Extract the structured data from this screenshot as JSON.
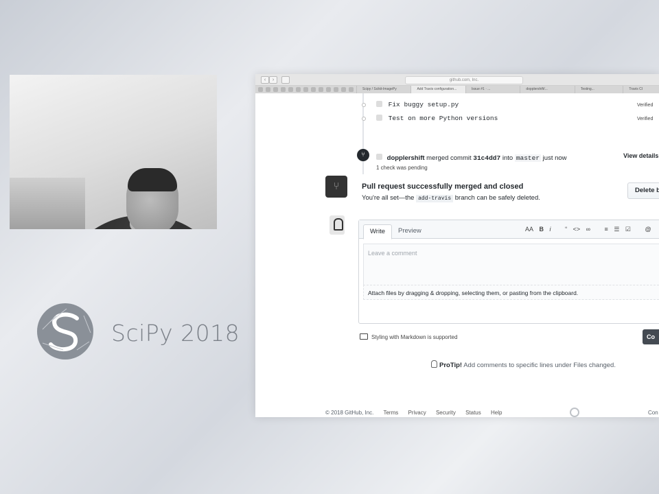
{
  "scipy": {
    "title": "SciPy 2018"
  },
  "browser": {
    "url": "github.com, Inc.",
    "tabs": [
      "Scipy / Scikit-ImagePy",
      "Add Travis configuration...",
      "Issue #1 · ...",
      "dopplershift/...",
      "Testing...",
      "Travis CI"
    ]
  },
  "commits": [
    {
      "message": "Fix buggy setup.py",
      "status": "Verified"
    },
    {
      "message": "Test on more Python versions",
      "status": "Verified"
    }
  ],
  "merge_event": {
    "user": "dopplershift",
    "text_merged": "merged commit",
    "sha": "31c4dd7",
    "text_into": "into",
    "branch": "master",
    "time": "just now",
    "view_details": "View details",
    "check_note": "1 check was pending"
  },
  "merged_box": {
    "title": "Pull request successfully merged and closed",
    "sub_before": "You're all set—the",
    "branch": "add-travis",
    "sub_after": "branch can be safely deleted.",
    "delete_button": "Delete b"
  },
  "comment": {
    "tab_write": "Write",
    "tab_preview": "Preview",
    "toolbar": [
      "AA",
      "B",
      "i",
      "“",
      "<>",
      "∞",
      "≡",
      "☰",
      "☑",
      "@"
    ],
    "placeholder": "Leave a comment",
    "attach_note": "Attach files by dragging & dropping, selecting them, or pasting from the clipboard.",
    "markdown_note": "Styling with Markdown is supported",
    "submit_button": "Co"
  },
  "protip": {
    "label": "ProTip!",
    "text": "Add comments to specific lines under Files changed."
  },
  "footer": {
    "copyright": "© 2018 GitHub, Inc.",
    "links": [
      "Terms",
      "Privacy",
      "Security",
      "Status",
      "Help"
    ],
    "right": "Con"
  }
}
